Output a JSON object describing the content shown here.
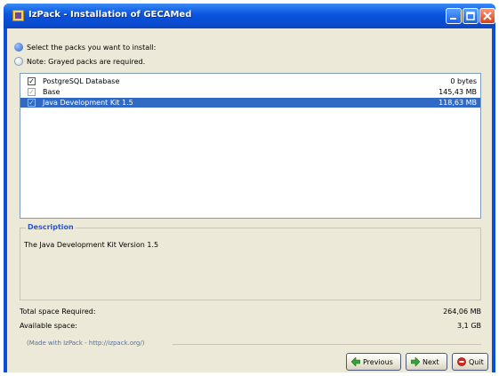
{
  "window": {
    "title": "IzPack - Installation of GECAMed"
  },
  "header": {
    "select_text": "Select the packs you want to install:",
    "note_text": "Note: Grayed packs are required."
  },
  "packs": [
    {
      "name": "PostgreSQL Database",
      "size": "0 bytes",
      "checked": true,
      "grayed": false,
      "selected": false
    },
    {
      "name": "Base",
      "size": "145,43 MB",
      "checked": true,
      "grayed": true,
      "selected": false
    },
    {
      "name": "Java Development Kit 1.5",
      "size": "118,63 MB",
      "checked": true,
      "grayed": true,
      "selected": true
    }
  ],
  "description": {
    "legend": "Description",
    "text": "The Java Development Kit Version 1.5"
  },
  "space": {
    "required_label": "Total space Required:",
    "required_value": "264,06 MB",
    "available_label": "Available space:",
    "available_value": "3,1 GB"
  },
  "footer": {
    "made_with": "(Made with IzPack - http://izpack.org/)"
  },
  "buttons": {
    "previous": "Previous",
    "next": "Next",
    "quit": "Quit"
  },
  "colors": {
    "titlebar": "#0a4fd8",
    "selection": "#316ac5",
    "legend": "#2b57c8"
  }
}
